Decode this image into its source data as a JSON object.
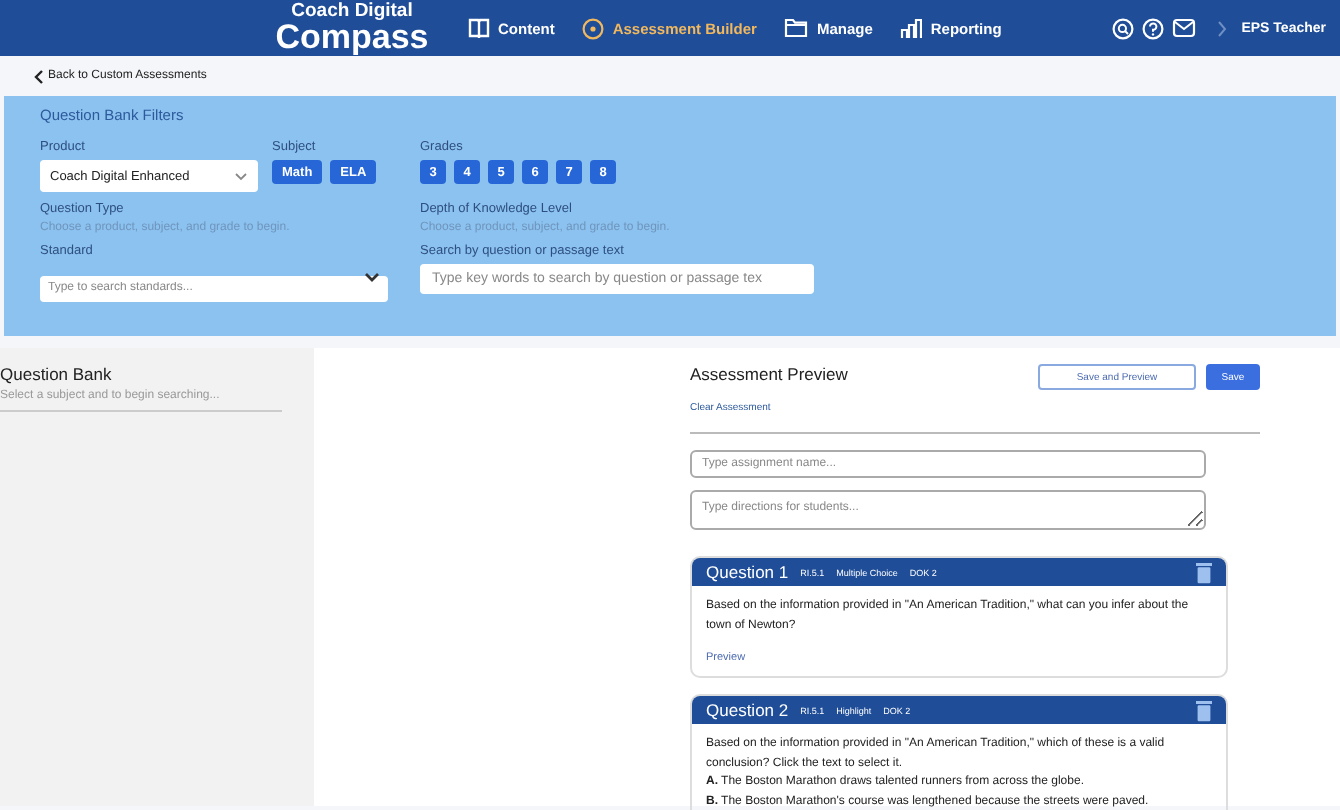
{
  "brand": {
    "top": "Coach Digital",
    "main": "Compass"
  },
  "nav": [
    {
      "label": "Content",
      "selected": false
    },
    {
      "label": "Assessment Builder",
      "selected": true
    },
    {
      "label": "Manage",
      "selected": false
    },
    {
      "label": "Reporting",
      "selected": false
    }
  ],
  "user": "EPS Teacher",
  "back_link": "Back to Custom Assessments",
  "filters": {
    "title": "Question Bank Filters",
    "product": {
      "label": "Product",
      "value": "Coach Digital Enhanced"
    },
    "subject": {
      "label": "Subject",
      "options": [
        "Math",
        "ELA"
      ]
    },
    "grades": {
      "label": "Grades",
      "options": [
        "3",
        "4",
        "5",
        "6",
        "7",
        "8"
      ]
    },
    "question_type": {
      "label": "Question Type",
      "hint": "Choose a product, subject, and grade to begin."
    },
    "dok": {
      "label": "Depth of Knowledge Level",
      "hint": "Choose a product, subject, and grade to begin."
    },
    "standard": {
      "label": "Standard",
      "placeholder": "Type to search standards..."
    },
    "search": {
      "label": "Search by question or passage text",
      "placeholder": "Type key words to search by question or passage tex"
    }
  },
  "question_bank": {
    "title": "Question Bank",
    "hint": "Select a subject and to begin searching..."
  },
  "preview": {
    "title": "Assessment Preview",
    "clear_link": "Clear Assessment",
    "buttons": [
      "Save and Preview",
      "Save"
    ],
    "name_placeholder": "Type assignment name...",
    "directions_placeholder": "Type directions for students...",
    "questions": [
      {
        "title": "Question 1",
        "tags": [
          "RI.5.1",
          "Multiple Choice",
          "DOK 2"
        ],
        "lines": [
          "Based on the information provided in \"An American Tradition,\" what can you infer about the town of Newton?"
        ],
        "link": "Preview"
      },
      {
        "title": "Question 2",
        "tags": [
          "RI.5.1",
          "Highlight",
          "DOK 2"
        ],
        "lines": [
          "Based on the information provided in \"An American Tradition,\" which of these is a valid conclusion? Click the text to select it.",
          "**A.** The Boston Marathon draws talented runners from across the globe.",
          "**B.** The Boston Marathon's course was lengthened because the streets were paved."
        ]
      }
    ]
  }
}
